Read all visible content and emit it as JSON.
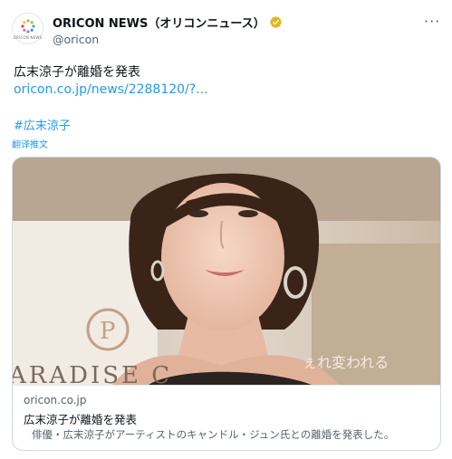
{
  "account": {
    "display_name": "ORICON NEWS（オリコンニュース）",
    "handle": "@oricon",
    "avatar_text": "ORICON NEWS"
  },
  "tweet": {
    "text": "広末涼子が離婚を発表",
    "link": "oricon.co.jp/news/2288120/?...",
    "hashtag": "#広末涼子",
    "translate_label": "翻译推文"
  },
  "card": {
    "image_text_left": "ARADISE C",
    "image_text_right": "ぇれ変われる",
    "domain": "oricon.co.jp",
    "title": "広末涼子が離婚を発表",
    "description": "俳優・広末涼子がアーティストのキャンドル・ジュン氏との離婚を発表した。"
  },
  "colors": {
    "link": "#1d9bf0",
    "verified_badge": "#e2b719",
    "secondary_text": "#536471"
  },
  "icons": {
    "verified": "verified-gold-badge-icon",
    "more": "more-options-icon"
  }
}
